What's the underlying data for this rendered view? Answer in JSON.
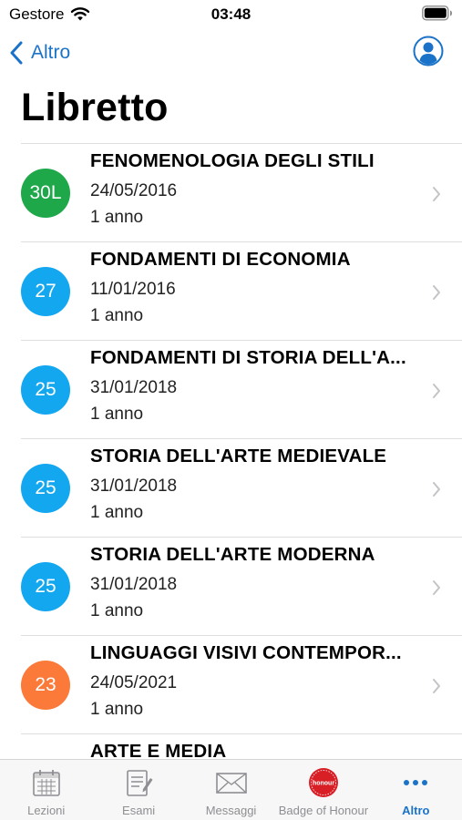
{
  "status_bar": {
    "carrier": "Gestore",
    "time": "03:48"
  },
  "nav": {
    "back_label": "Altro"
  },
  "page": {
    "title": "Libretto"
  },
  "colors": {
    "accent": "#1a73c8",
    "badge_green": "#1ea84a",
    "badge_blue": "#12a7ef",
    "badge_orange": "#fb7a3a"
  },
  "exams": [
    {
      "grade": "30L",
      "grade_color": "#1ea84a",
      "name": "FENOMENOLOGIA DEGLI STILI",
      "date": "24/05/2016",
      "duration": "1 anno"
    },
    {
      "grade": "27",
      "grade_color": "#12a7ef",
      "name": "FONDAMENTI DI ECONOMIA",
      "date": "11/01/2016",
      "duration": "1 anno"
    },
    {
      "grade": "25",
      "grade_color": "#12a7ef",
      "name": "FONDAMENTI DI STORIA DELL'A...",
      "date": "31/01/2018",
      "duration": "1 anno"
    },
    {
      "grade": "25",
      "grade_color": "#12a7ef",
      "name": "STORIA DELL'ARTE MEDIEVALE",
      "date": "31/01/2018",
      "duration": "1 anno"
    },
    {
      "grade": "25",
      "grade_color": "#12a7ef",
      "name": "STORIA DELL'ARTE MODERNA",
      "date": "31/01/2018",
      "duration": "1 anno"
    },
    {
      "grade": "23",
      "grade_color": "#fb7a3a",
      "name": "LINGUAGGI VISIVI CONTEMPOR...",
      "date": "24/05/2021",
      "duration": "1 anno"
    },
    {
      "grade": "",
      "grade_color": "#fb7a3a",
      "name": "ARTE E MEDIA",
      "date": "",
      "duration": ""
    }
  ],
  "tab_bar": {
    "tabs": [
      {
        "label": "Lezioni",
        "icon": "calendar-icon",
        "active": false
      },
      {
        "label": "Esami",
        "icon": "exam-notepad-icon",
        "active": false
      },
      {
        "label": "Messaggi",
        "icon": "envelope-icon",
        "active": false
      },
      {
        "label": "Badge of Honour",
        "icon": "honour-badge-icon",
        "badge_text": "honour",
        "active": false
      },
      {
        "label": "Altro",
        "icon": "more-dots-icon",
        "active": true
      }
    ]
  }
}
